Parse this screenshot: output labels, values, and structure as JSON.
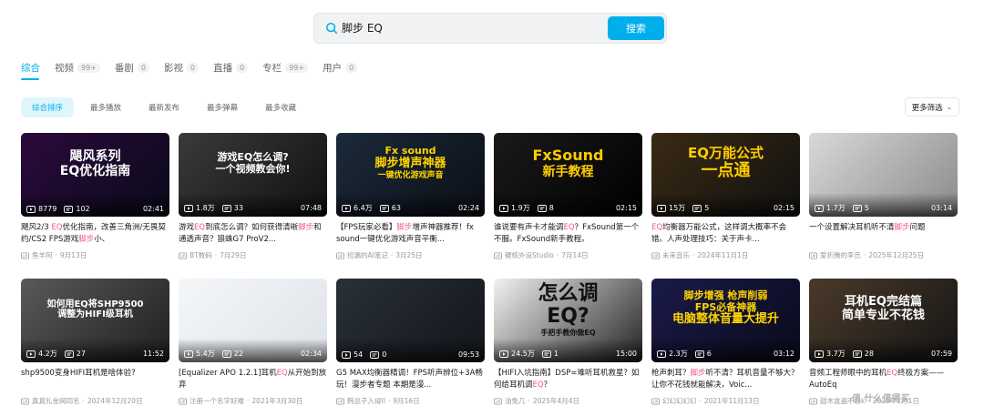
{
  "search": {
    "query": "脚步 EQ",
    "button_label": "搜索"
  },
  "tabs": [
    {
      "label": "综合",
      "badge": ""
    },
    {
      "label": "视频",
      "badge": "99+"
    },
    {
      "label": "番剧",
      "badge": "0"
    },
    {
      "label": "影视",
      "badge": "0"
    },
    {
      "label": "直播",
      "badge": "0"
    },
    {
      "label": "专栏",
      "badge": "99+"
    },
    {
      "label": "用户",
      "badge": "0"
    }
  ],
  "sort": {
    "items": [
      "综合排序",
      "最多播放",
      "最新发布",
      "最多弹幕",
      "最多收藏"
    ],
    "more_filter": "更多筛选"
  },
  "watermark": "值 什么值得买",
  "videos": [
    {
      "thumb_text": "飓风系列\nEQ优化指南",
      "thumb_colors": [
        "#2b0a3d",
        "#0a0a1a"
      ],
      "text_color": "#ffffff",
      "plays": "8779",
      "danmaku": "102",
      "duration": "02:41",
      "title_parts": [
        [
          "飓风2/3 ",
          false
        ],
        [
          "EQ",
          true
        ],
        [
          "优化指南，改善三角洲/无畏契约/CS2 FPS游戏",
          false
        ],
        [
          "脚步",
          true
        ],
        [
          "小、",
          false
        ]
      ],
      "author": "鱼羊阿",
      "date": "9月13日"
    },
    {
      "thumb_text": "游戏EQ怎么调?\n一个视频教会你!",
      "thumb_colors": [
        "#3a3a3a",
        "#111111"
      ],
      "text_color": "#ffffff",
      "plays": "1.8万",
      "danmaku": "33",
      "duration": "07:48",
      "title_parts": [
        [
          "游戏",
          false
        ],
        [
          "EQ",
          true
        ],
        [
          "到底怎么调？如何获得清晰",
          false
        ],
        [
          "脚步",
          true
        ],
        [
          "和通透声音？狼蛛G7 ProV2...",
          false
        ]
      ],
      "author": "BT数码",
      "date": "7月29日"
    },
    {
      "thumb_text": "Fx sound\n脚步增声神器\n一键优化游戏声音",
      "thumb_colors": [
        "#1c2a3a",
        "#0b0f16"
      ],
      "text_color": "#ffd400",
      "plays": "6.4万",
      "danmaku": "63",
      "duration": "02:24",
      "title_parts": [
        [
          "【FPS玩家必看】",
          false
        ],
        [
          "脚步",
          true
        ],
        [
          "增声神器推荐！fx sound一键优化游戏声音平衡...",
          false
        ]
      ],
      "author": "捡漏的AI笔记",
      "date": "3月25日"
    },
    {
      "thumb_text": "FxSound\n新手教程",
      "thumb_colors": [
        "#1a1a1a",
        "#000000"
      ],
      "text_color": "#ffcc00",
      "plays": "1.9万",
      "danmaku": "8",
      "duration": "02:15",
      "title_parts": [
        [
          "谁说要有声卡才能调",
          false
        ],
        [
          "EQ",
          true
        ],
        [
          "？FxSound第一个不服。FxSound新手教程。",
          false
        ]
      ],
      "author": "硬核外设Studio",
      "date": "7月14日"
    },
    {
      "thumb_text": "EQ万能公式\n一点通",
      "thumb_colors": [
        "#3a2a14",
        "#111111"
      ],
      "text_color": "#ffcc00",
      "plays": "15万",
      "danmaku": "5",
      "duration": "02:15",
      "title_parts": [
        [
          "EQ",
          true
        ],
        [
          "均衡器万能公式，这样调大概率不会错。人声处理技巧：关于声卡...",
          false
        ]
      ],
      "author": "未来音乐",
      "date": "2024年11月1日"
    },
    {
      "thumb_text": "",
      "thumb_colors": [
        "#d9d9d9",
        "#8a8a8a"
      ],
      "text_color": "#ffffff",
      "plays": "1.7万",
      "danmaku": "5",
      "duration": "03:14",
      "title_parts": [
        [
          "一个设置解决耳机听不清",
          false
        ],
        [
          "脚步",
          true
        ],
        [
          "问题",
          false
        ]
      ],
      "author": "爱折腾的李氏",
      "date": "2025年12月25日"
    },
    {
      "thumb_text": "如何用EQ将SHP9500\n调整为HIFI级耳机",
      "thumb_colors": [
        "#5a5a5a",
        "#1e1e1e"
      ],
      "text_color": "#ffffff",
      "plays": "4.2万",
      "danmaku": "27",
      "duration": "11:52",
      "title_parts": [
        [
          "shp9500变身HIFI耳机是啥体验?",
          false
        ]
      ],
      "author": "真真扎金网同名",
      "date": "2024年12月20日"
    },
    {
      "thumb_text": "",
      "thumb_colors": [
        "#f4f6f8",
        "#dfe4ea"
      ],
      "text_color": "#333333",
      "plays": "5.4万",
      "danmaku": "22",
      "duration": "02:34",
      "title_parts": [
        [
          "[Equalizer APO 1.2.1]耳机",
          false
        ],
        [
          "EQ",
          true
        ],
        [
          "从开始到放弃",
          false
        ]
      ],
      "author": "注册一个名字好难",
      "date": "2021年3月30日"
    },
    {
      "thumb_text": "",
      "thumb_colors": [
        "#2a3038",
        "#12161b"
      ],
      "text_color": "#ffffff",
      "plays": "54",
      "danmaku": "0",
      "duration": "09:53",
      "title_parts": [
        [
          "G5 MAX均衡器精调！FPS听声辨位+3A畅玩！漫步者专题 本期是漫...",
          false
        ]
      ],
      "author": "韩总子入侵II",
      "date": "9月16日"
    },
    {
      "thumb_text": "怎么调\nEQ?\n手把手教你做EQ",
      "thumb_colors": [
        "#f2f2f2",
        "#222222"
      ],
      "text_color": "#111111",
      "plays": "24.5万",
      "danmaku": "1",
      "duration": "15:00",
      "title_parts": [
        [
          "【HIFI入坑指南】DSP=难听耳机救星？如何给耳机调",
          false
        ],
        [
          "EQ",
          true
        ],
        [
          "？",
          false
        ]
      ],
      "author": "油兔几",
      "date": "2025年4月4日"
    },
    {
      "thumb_text": "脚步增强 枪声削弱\nFPS必备神器\n电脑整体音量大提升",
      "thumb_colors": [
        "#1a1a4a",
        "#0a0a1a"
      ],
      "text_color": "#ffd400",
      "plays": "2.3万",
      "danmaku": "6",
      "duration": "03:12",
      "title_parts": [
        [
          "枪声刺耳？",
          false
        ],
        [
          "脚步",
          true
        ],
        [
          "听不清？耳机音量不够大？让你不花钱就能解决，Voic...",
          false
        ]
      ],
      "author": "幻幻幻幻幻",
      "date": "2021年11月13日"
    },
    {
      "thumb_text": "耳机EQ完结篇\n简单专业不花钱",
      "thumb_colors": [
        "#4a3a2a",
        "#151515"
      ],
      "text_color": "#ffffff",
      "plays": "3.7万",
      "danmaku": "28",
      "duration": "07:59",
      "title_parts": [
        [
          "音频工程师眼中的耳机",
          false
        ],
        [
          "EQ",
          true
        ],
        [
          "终极方案——AutoEq",
          false
        ]
      ],
      "author": "甜木盒遍不念k",
      "date": "2025年1月1日"
    }
  ]
}
